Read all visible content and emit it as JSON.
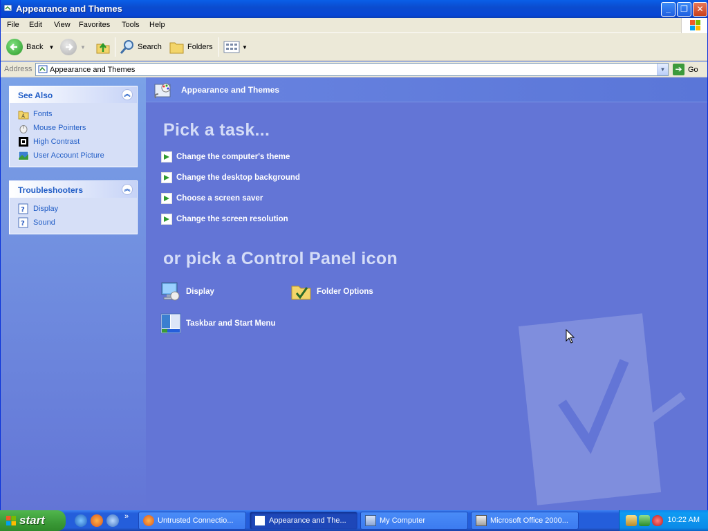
{
  "window": {
    "title": "Appearance and Themes"
  },
  "menu": [
    "File",
    "Edit",
    "View",
    "Favorites",
    "Tools",
    "Help"
  ],
  "toolbar": {
    "back": "Back",
    "search": "Search",
    "folders": "Folders"
  },
  "address": {
    "label": "Address",
    "value": "Appearance and Themes",
    "go": "Go"
  },
  "see_also": {
    "title": "See Also",
    "items": [
      "Fonts",
      "Mouse Pointers",
      "High Contrast",
      "User Account Picture"
    ]
  },
  "troubleshooters": {
    "title": "Troubleshooters",
    "items": [
      "Display",
      "Sound"
    ]
  },
  "main": {
    "header": "Appearance and Themes",
    "pick_task": "Pick a task...",
    "tasks": [
      "Change the computer's theme",
      "Change the desktop background",
      "Choose a screen saver",
      "Change the screen resolution"
    ],
    "pick_icon": "or pick a Control Panel icon",
    "icons": [
      "Display",
      "Folder Options",
      "Taskbar and Start Menu"
    ]
  },
  "taskbar": {
    "start": "start",
    "buttons": [
      "Untrusted Connectio...",
      "Appearance and The...",
      "My Computer",
      "Microsoft Office 2000..."
    ],
    "clock": "10:22 AM"
  }
}
